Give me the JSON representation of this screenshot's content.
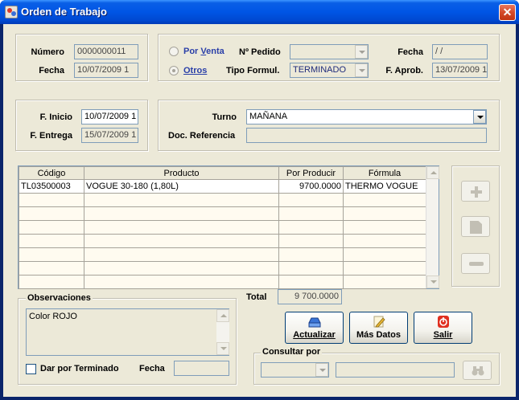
{
  "window": {
    "title": "Orden de Trabajo",
    "close_label": "✕"
  },
  "header": {
    "numero_label": "Número",
    "numero_value": "0000000011",
    "fecha_label": "Fecha",
    "fecha_value": "10/07/2009 1",
    "por_venta_label": "Por Venta",
    "por_venta_mnemonic": "V",
    "otros_label": "Otros",
    "otros_mnemonic": "O",
    "pedido_label": "Nº Pedido",
    "pedido_value": "",
    "tipo_formul_label": "Tipo Formul.",
    "tipo_formul_value": "TERMINADO",
    "fecha_right_label": "Fecha",
    "fecha_right_value": " / /",
    "f_aprob_label": "F. Aprob.",
    "f_aprob_value": "13/07/2009 1"
  },
  "dates": {
    "f_inicio_label": "F. Inicio",
    "f_inicio_value": "10/07/2009 1",
    "f_entrega_label": "F. Entrega",
    "f_entrega_value": "15/07/2009 1",
    "turno_label": "Turno",
    "turno_value": "MAÑANA",
    "doc_ref_label": "Doc. Referencia",
    "doc_ref_value": ""
  },
  "grid": {
    "columns": [
      "Código",
      "Producto",
      "Por Producir",
      "Fórmula"
    ],
    "rows": [
      {
        "codigo": "TL03500003",
        "producto": "VOGUE 30-180 (1,80L)",
        "por_producir": "9700.0000",
        "formula": "THERMO VOGUE"
      }
    ]
  },
  "total": {
    "label": "Total",
    "value": "9 700.0000"
  },
  "observaciones": {
    "legend": "Observaciones",
    "text": "Color ROJO"
  },
  "terminado": {
    "label": "Dar por Terminado",
    "fecha_label": "Fecha",
    "fecha_value": ""
  },
  "actions": {
    "actualizar_label": "Actualizar",
    "actualizar_mnemonic": "A",
    "mas_datos_label": "Más Datos",
    "salir_label": "Salir",
    "salir_mnemonic": "S"
  },
  "consultar": {
    "legend": "Consultar por",
    "select_value": "",
    "text_value": ""
  },
  "icons": {
    "app": "app-icon",
    "add": "plus-icon",
    "edit": "page-icon",
    "delete": "minus-icon",
    "actualizar": "tray-icon",
    "mas_datos": "pencil-icon",
    "salir": "power-icon",
    "search": "binoculars-icon"
  },
  "colors": {
    "title_bar": "#0055e5",
    "radio_label": "#2a3fa8",
    "salir_icon": "#e03020"
  }
}
